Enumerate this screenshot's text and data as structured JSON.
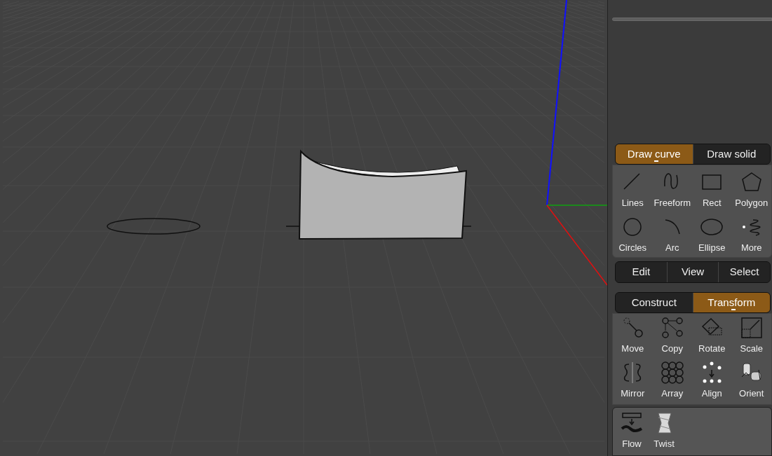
{
  "draw_tabs": [
    {
      "label": "Draw curve",
      "selected": true
    },
    {
      "label": "Draw solid",
      "selected": false
    }
  ],
  "curve_tools": [
    {
      "label": "Lines"
    },
    {
      "label": "Freeform"
    },
    {
      "label": "Rect"
    },
    {
      "label": "Polygon"
    },
    {
      "label": "Circles"
    },
    {
      "label": "Arc"
    },
    {
      "label": "Ellipse"
    },
    {
      "label": "More"
    }
  ],
  "menu": [
    "Edit",
    "View",
    "Select"
  ],
  "mode_tabs": [
    {
      "label": "Construct",
      "selected": false
    },
    {
      "label": "Transform",
      "selected": true
    }
  ],
  "transform_tools": [
    {
      "label": "Move"
    },
    {
      "label": "Copy"
    },
    {
      "label": "Rotate"
    },
    {
      "label": "Scale"
    },
    {
      "label": "Mirror"
    },
    {
      "label": "Array"
    },
    {
      "label": "Align"
    },
    {
      "label": "Orient"
    }
  ],
  "extra_tools": [
    {
      "label": "Flow"
    },
    {
      "label": "Twist"
    }
  ]
}
